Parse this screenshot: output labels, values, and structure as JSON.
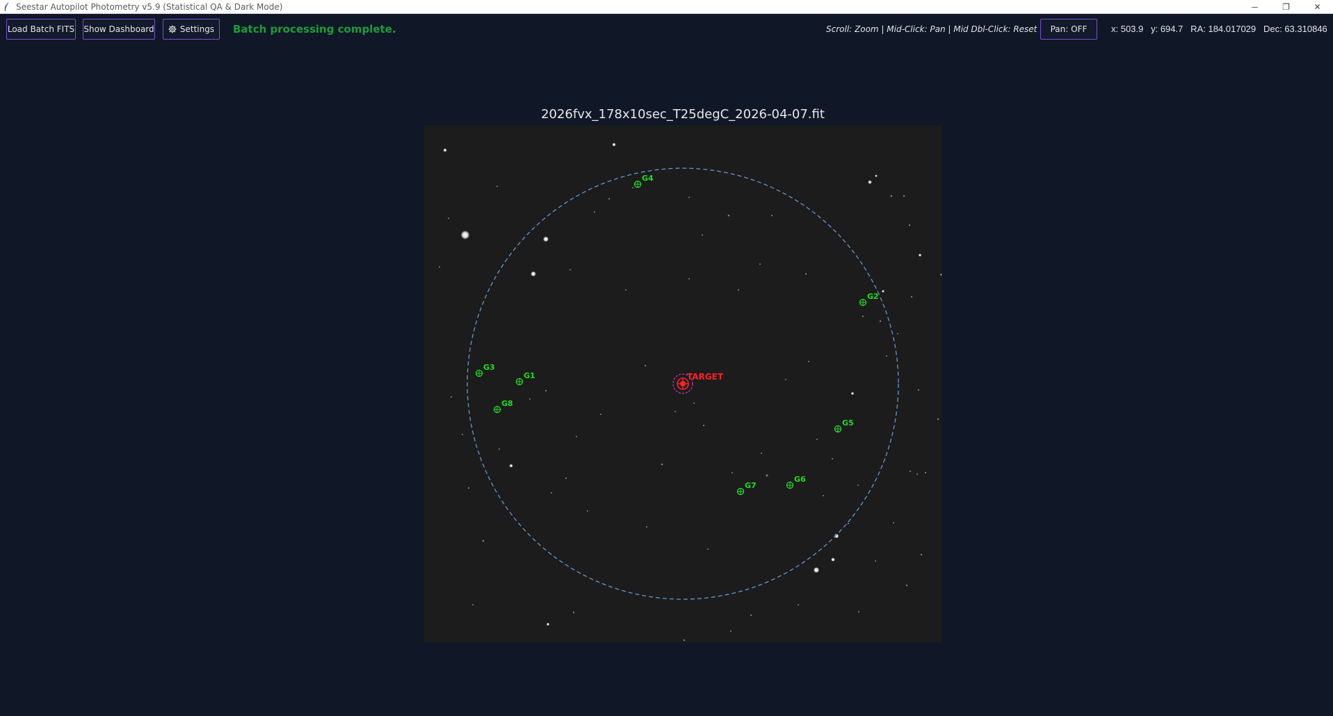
{
  "window": {
    "title": "Seestar Autopilot Photometry v5.9 (Statistical QA & Dark Mode)",
    "controls": [
      "─",
      "❐",
      "✕"
    ]
  },
  "toolbar": {
    "load_label": "Load Batch FITS",
    "dashboard_label": "Show Dashboard",
    "settings_label": "Settings",
    "status": "Batch processing complete.",
    "hint": "Scroll: Zoom | Mid-Click: Pan | Mid Dbl-Click: Reset",
    "pan_label": "Pan: OFF",
    "coords": "x: 503.9   y: 694.7   RA: 184.017029   Dec: 63.310846"
  },
  "image": {
    "filename": "2026fvx_178x10sec_T25degC_2026-04-07.fit",
    "target_label": "TARGET",
    "guide_stars": [
      {
        "label": "G1"
      },
      {
        "label": "G2"
      },
      {
        "label": "G3"
      },
      {
        "label": "G4"
      },
      {
        "label": "G5"
      },
      {
        "label": "G6"
      },
      {
        "label": "G7"
      },
      {
        "label": "G8"
      }
    ]
  },
  "colors": {
    "background": "#101828",
    "accent_border": "#7a4fd6",
    "status_green": "#1e9c3a",
    "comp_star_green": "#22dd22",
    "target_red": "#ff2222",
    "target_ring_magenta": "#c23bd4",
    "field_circle_blue": "#5b9bd5"
  }
}
